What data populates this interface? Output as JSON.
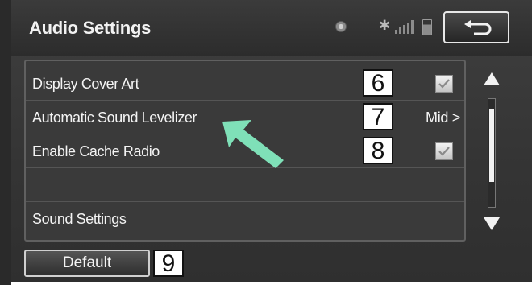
{
  "header": {
    "title": "Audio Settings",
    "icons": [
      "gps-icon",
      "bluetooth-icon",
      "signal-icon",
      "battery-icon"
    ],
    "back_button_icon": "return-arrow-icon"
  },
  "settings": {
    "items": [
      {
        "label": "Display Cover Art",
        "type": "checkbox",
        "checked": true,
        "callout": "6"
      },
      {
        "label": "Automatic Sound Levelizer",
        "type": "value",
        "value": "Mid >",
        "callout": "7"
      },
      {
        "label": "Enable Cache Radio",
        "type": "checkbox",
        "checked": true,
        "callout": "8"
      },
      {
        "label": "",
        "type": "empty"
      },
      {
        "label": "Sound Settings",
        "type": "link"
      }
    ]
  },
  "scrollbar": {
    "up_icon": "scroll-up-arrow-icon",
    "down_icon": "scroll-down-arrow-icon",
    "position_fraction": 0.3
  },
  "footer": {
    "default_label": "Default",
    "default_callout": "9"
  },
  "annotation": {
    "arrow_icon": "pointer-arrow-icon",
    "arrow_color": "#7fe0b8"
  },
  "colors": {
    "panel": "#363636",
    "text": "#f3f3f3",
    "accent_arrow": "#7fe0b8"
  }
}
